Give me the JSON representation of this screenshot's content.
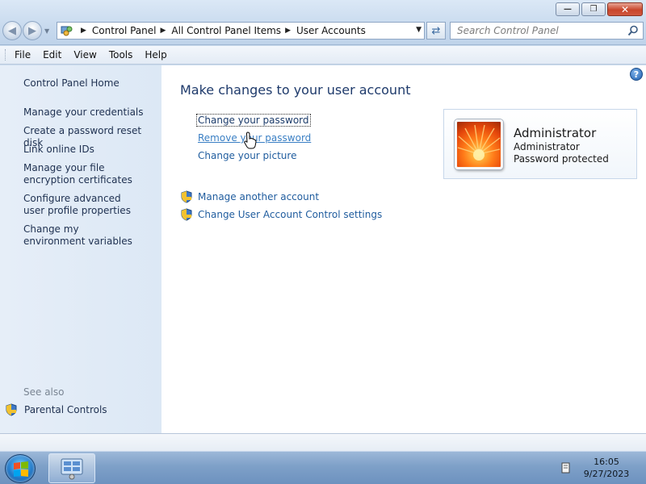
{
  "window": {
    "minimize_icon": "minimize-icon",
    "maximize_icon": "maximize-icon",
    "close_icon": "close-icon"
  },
  "address_bar": {
    "crumbs": [
      "Control Panel",
      "All Control Panel Items",
      "User Accounts"
    ]
  },
  "search": {
    "placeholder": "Search Control Panel"
  },
  "menu": {
    "items": [
      "File",
      "Edit",
      "View",
      "Tools",
      "Help"
    ]
  },
  "sidebar": {
    "home": "Control Panel Home",
    "links": [
      "Manage your credentials",
      "Create a password reset disk",
      "Link online IDs",
      "Manage your file encryption certificates",
      "Configure advanced user profile properties",
      "Change my environment variables"
    ],
    "see_also_label": "See also",
    "see_also_items": [
      "Parental Controls"
    ]
  },
  "main": {
    "heading": "Make changes to your user account",
    "tasks": [
      "Change your password",
      "Remove your password",
      "Change your picture"
    ],
    "shield_tasks": [
      "Manage another account",
      "Change User Account Control settings"
    ],
    "help_label": "?"
  },
  "account": {
    "name": "Administrator",
    "type": "Administrator",
    "status": "Password protected"
  },
  "taskbar": {
    "time": "16:05",
    "date": "9/27/2023"
  },
  "colors": {
    "link": "#1f5c9e",
    "heading": "#1e3a6b",
    "sidebar_bg": "#dce8f5"
  }
}
